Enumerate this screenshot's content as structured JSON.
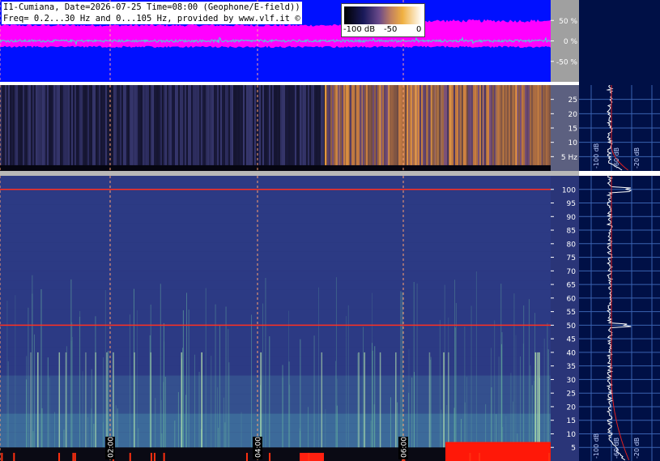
{
  "header": {
    "line1": "I1-Cumiana, Date=2026-07-25 Time=08:00 (Geophone/E-field))",
    "line2": "Freq= 0.2...30 Hz and 0...105 Hz, provided by www.vlf.it ©"
  },
  "colorbar": {
    "labels": [
      "-100 dB",
      "-50",
      "0"
    ]
  },
  "chart_data": [
    {
      "type": "area",
      "name": "waveform-panel",
      "y_ticks": [
        50,
        0,
        -50
      ],
      "y_tick_labels": [
        "50 %",
        "0 %",
        "-50 %"
      ],
      "ylim": [
        -100,
        100
      ],
      "colors": {
        "background": "#0010ff",
        "envelope": "#ff00ff",
        "trace": "#40e0d0"
      }
    },
    {
      "type": "heatmap",
      "name": "spectrogram-low",
      "ylim": [
        0,
        30
      ],
      "y_ticks": [
        5,
        10,
        15,
        20,
        25
      ],
      "y_tick_labels": [
        "5 Hz",
        "10",
        "15",
        "20",
        "25"
      ]
    },
    {
      "type": "heatmap",
      "name": "spectrogram-high",
      "ylim": [
        0,
        105
      ],
      "y_ticks": [
        5,
        10,
        15,
        20,
        25,
        30,
        35,
        40,
        45,
        50,
        55,
        60,
        65,
        70,
        75,
        80,
        85,
        90,
        95,
        100
      ],
      "time_ticks": [
        "02:00",
        "04:00",
        "06:00"
      ],
      "lines": [
        {
          "freq": 50,
          "color": "#ff3020"
        },
        {
          "freq": 100,
          "color": "#ff3020"
        }
      ]
    },
    {
      "type": "line",
      "name": "spectrum-profile",
      "x_tick_labels_low": [
        "-100 dB",
        "-60 dB",
        "-20 dB"
      ],
      "x_tick_labels_high": [
        "-100 dB",
        "-60 dB",
        "-20 dB"
      ]
    }
  ]
}
